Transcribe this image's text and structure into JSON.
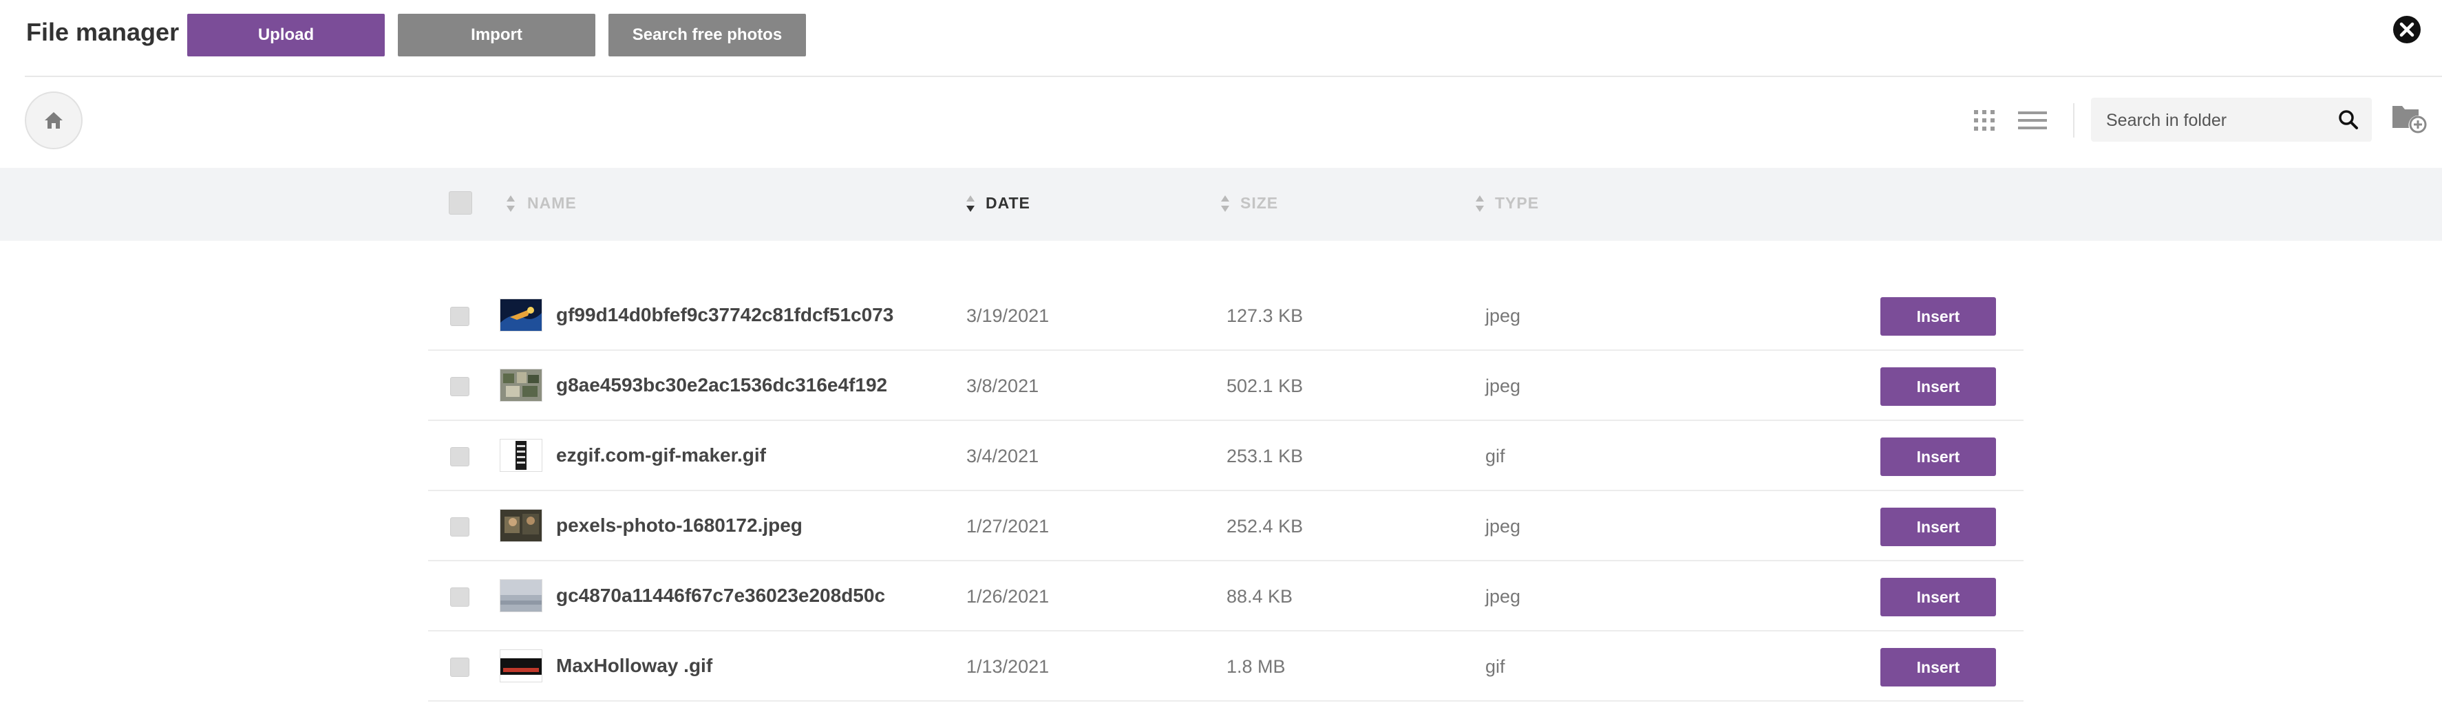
{
  "header": {
    "title": "File manager",
    "upload_label": "Upload",
    "import_label": "Import",
    "search_photos_label": "Search free photos"
  },
  "toolbar": {
    "search_placeholder": "Search in folder",
    "icons": [
      "home-icon",
      "grid-view-icon",
      "list-view-icon",
      "search-icon",
      "new-folder-icon",
      "close-icon"
    ]
  },
  "columns": {
    "name": "NAME",
    "date": "DATE",
    "size": "SIZE",
    "type": "TYPE",
    "sorted_by": "DATE"
  },
  "files": [
    {
      "name": "gf99d14d0bfef9c37742c81fdcf51c073",
      "date": "3/19/2021",
      "size": "127.3 KB",
      "type": "jpeg",
      "action": "Insert"
    },
    {
      "name": "g8ae4593bc30e2ac1536dc316e4f192",
      "date": "3/8/2021",
      "size": "502.1 KB",
      "type": "jpeg",
      "action": "Insert"
    },
    {
      "name": "ezgif.com-gif-maker.gif",
      "date": "3/4/2021",
      "size": "253.1 KB",
      "type": "gif",
      "action": "Insert"
    },
    {
      "name": "pexels-photo-1680172.jpeg",
      "date": "1/27/2021",
      "size": "252.4 KB",
      "type": "jpeg",
      "action": "Insert"
    },
    {
      "name": "gc4870a11446f67c7e36023e208d50c",
      "date": "1/26/2021",
      "size": "88.4 KB",
      "type": "jpeg",
      "action": "Insert"
    },
    {
      "name": "MaxHolloway .gif",
      "date": "1/13/2021",
      "size": "1.8 MB",
      "type": "gif",
      "action": "Insert"
    }
  ],
  "colors": {
    "accent": "#7b4d98",
    "secondary_button": "#868686",
    "header_bg": "#f2f3f5"
  }
}
